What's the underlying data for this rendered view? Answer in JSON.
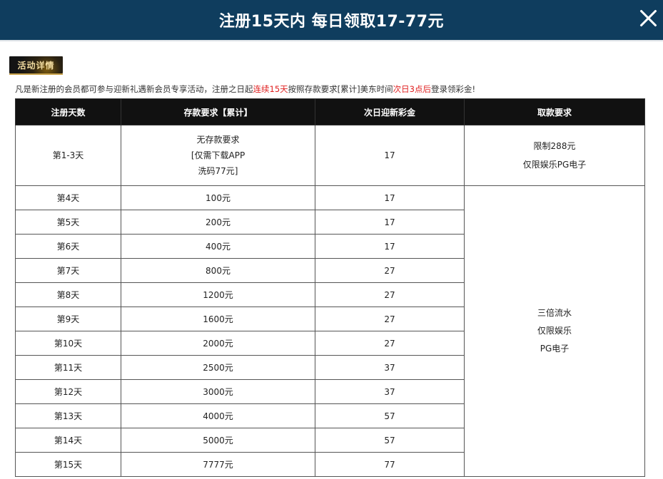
{
  "header": {
    "title": "注册15天内 每日领取17-77元"
  },
  "badge": {
    "label": "活动详情"
  },
  "intro": {
    "part1": "凡是新注册的会员都可参与迎新礼遇新会员专享活动，注册之日起",
    "part2_red": "连续15天",
    "part3": "按照存款要求[累计]美东时间",
    "part4_red": "次日3点后",
    "part5": "登录领彩金!"
  },
  "table": {
    "headers": [
      "注册天数",
      "存款要求【累计】",
      "次日迎新彩金",
      "取款要求"
    ],
    "first_row": {
      "day": "第1-3天",
      "deposit_lines": [
        "无存款要求",
        "[仅需下载APP",
        "洗码77元]"
      ],
      "bonus": "17",
      "withdraw_lines": [
        "限制288元",
        "仅限娱乐PG电子"
      ]
    },
    "rows": [
      {
        "day": "第4天",
        "deposit": "100元",
        "bonus": "17"
      },
      {
        "day": "第5天",
        "deposit": "200元",
        "bonus": "17"
      },
      {
        "day": "第6天",
        "deposit": "400元",
        "bonus": "17"
      },
      {
        "day": "第7天",
        "deposit": "800元",
        "bonus": "27"
      },
      {
        "day": "第8天",
        "deposit": "1200元",
        "bonus": "27"
      },
      {
        "day": "第9天",
        "deposit": "1600元",
        "bonus": "27"
      },
      {
        "day": "第10天",
        "deposit": "2000元",
        "bonus": "27"
      },
      {
        "day": "第11天",
        "deposit": "2500元",
        "bonus": "37"
      },
      {
        "day": "第12天",
        "deposit": "3000元",
        "bonus": "37"
      },
      {
        "day": "第13天",
        "deposit": "4000元",
        "bonus": "57"
      },
      {
        "day": "第14天",
        "deposit": "5000元",
        "bonus": "57"
      },
      {
        "day": "第15天",
        "deposit": "7777元",
        "bonus": "77"
      }
    ],
    "merged_withdraw_lines": [
      "三倍流水",
      "仅限娱乐",
      "PG电子"
    ]
  },
  "colors": {
    "header_bg": "#0f3d5e",
    "table_header_bg": "#111111",
    "highlight_red": "#e02020"
  },
  "icons": {
    "close": "close-icon"
  }
}
